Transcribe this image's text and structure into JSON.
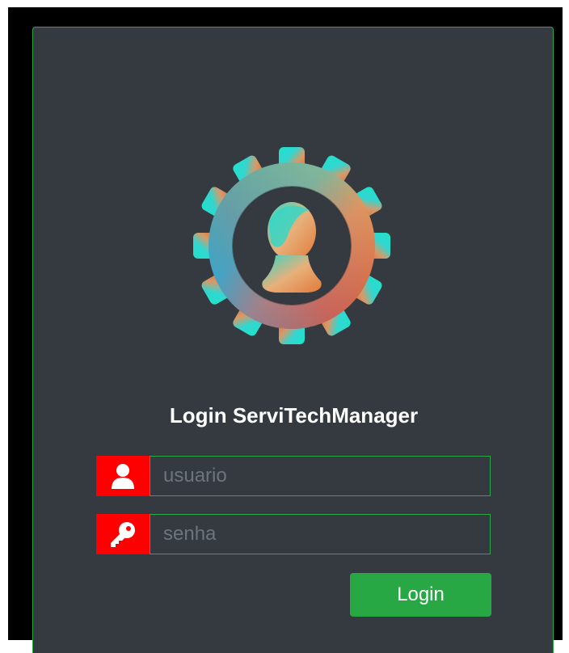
{
  "login": {
    "title": "Login ServiTechManager",
    "username_placeholder": "usuario",
    "password_placeholder": "senha",
    "submit_label": "Login"
  },
  "icons": {
    "logo": "gear-user-logo-icon",
    "username": "user-icon",
    "password": "key-icon"
  },
  "colors": {
    "page_background": "#000000",
    "card_background": "#343a40",
    "accent": "#28a745",
    "icon_addon": "#ff0000",
    "title_text": "#ffffff",
    "placeholder_text": "#6c757d"
  }
}
